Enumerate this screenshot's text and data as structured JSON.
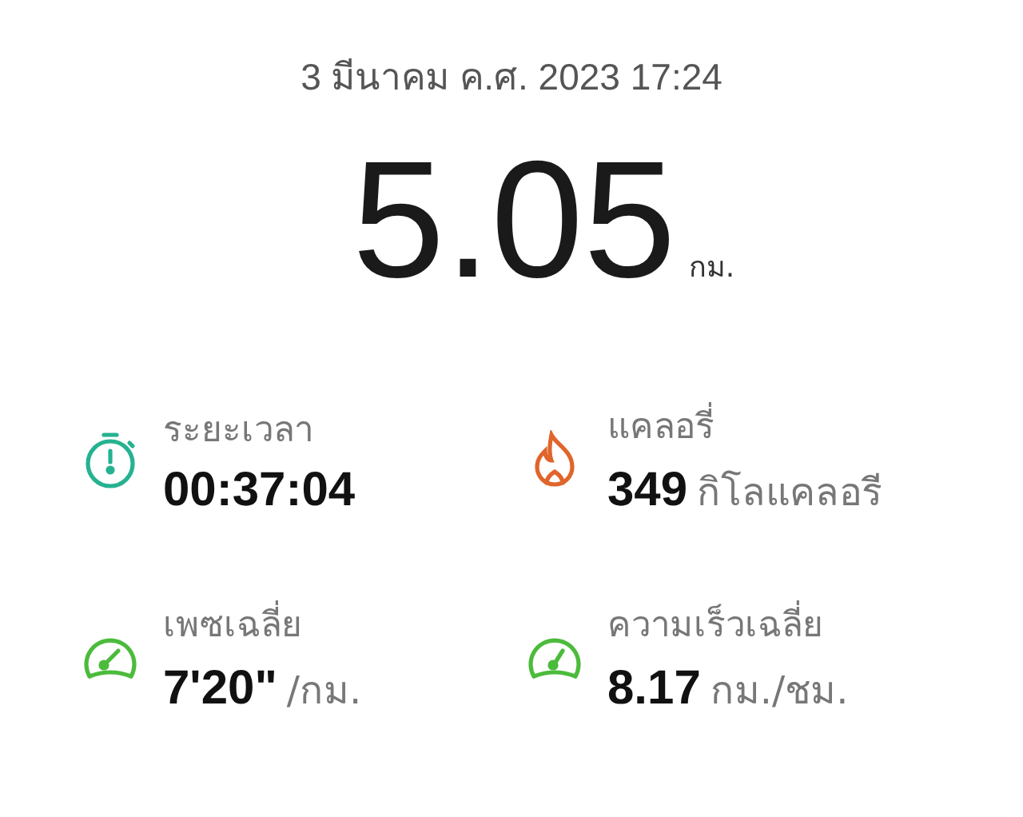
{
  "date": "3 มีนาคม ค.ศ. 2023 17:24",
  "distance": {
    "value": "5.05",
    "unit": "กม."
  },
  "stats": [
    {
      "kind": "duration",
      "color": "#26b290",
      "label": "ระยะเวลา",
      "value": "00:37:04"
    },
    {
      "kind": "calories",
      "color": "#e0652b",
      "label": "แคลอรี่",
      "value": "349",
      "unit": "กิโลแคลอรี"
    },
    {
      "kind": "pace",
      "color": "#4cbb3c",
      "label": "เพซเฉลี่ย",
      "value": "7'20\"",
      "unit": "/กม."
    },
    {
      "kind": "speed",
      "color": "#4cbb3c",
      "label": "ความเร็วเฉลี่ย",
      "value": "8.17",
      "unit": "กม./ชม."
    }
  ]
}
